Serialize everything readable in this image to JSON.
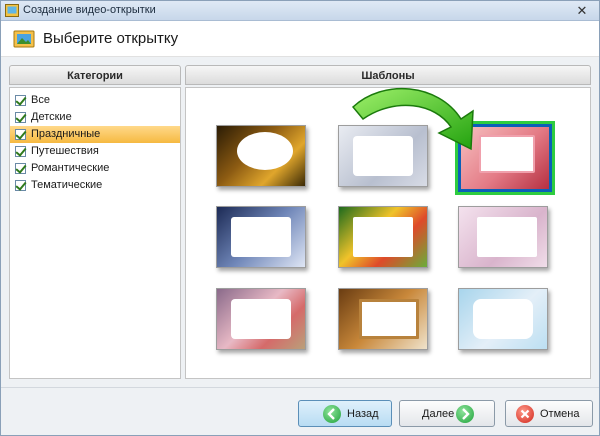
{
  "window": {
    "title": "Создание видео-открытки",
    "close_glyph": "✕"
  },
  "header": {
    "heading": "Выберите открытку",
    "icon": "postcard-icon"
  },
  "categories": {
    "header": "Категории",
    "items": [
      {
        "label": "Все",
        "checked": true,
        "selected": false
      },
      {
        "label": "Детские",
        "checked": true,
        "selected": false
      },
      {
        "label": "Праздничные",
        "checked": true,
        "selected": true
      },
      {
        "label": "Путешествия",
        "checked": true,
        "selected": false
      },
      {
        "label": "Романтические",
        "checked": true,
        "selected": false
      },
      {
        "label": "Тематические",
        "checked": true,
        "selected": false
      }
    ]
  },
  "templates": {
    "header": "Шаблоны",
    "selected_index": 2,
    "items": [
      {
        "name": "christmas-gifts"
      },
      {
        "name": "winter-blue-ornaments"
      },
      {
        "name": "pink-card-selected"
      },
      {
        "name": "snowman-night"
      },
      {
        "name": "flowers-tulips"
      },
      {
        "name": "pink-flowers"
      },
      {
        "name": "roses-vintage"
      },
      {
        "name": "gold-picture-frame"
      },
      {
        "name": "light-blue-lace"
      }
    ]
  },
  "footer": {
    "back_label": "Назад",
    "next_label": "Далее",
    "cancel_label": "Отмена"
  },
  "colors": {
    "selection_accent": "#f6b941",
    "selected_border": "#0a5fb8",
    "selected_glow": "#2ecc40",
    "arrow": "#3cc21a"
  }
}
